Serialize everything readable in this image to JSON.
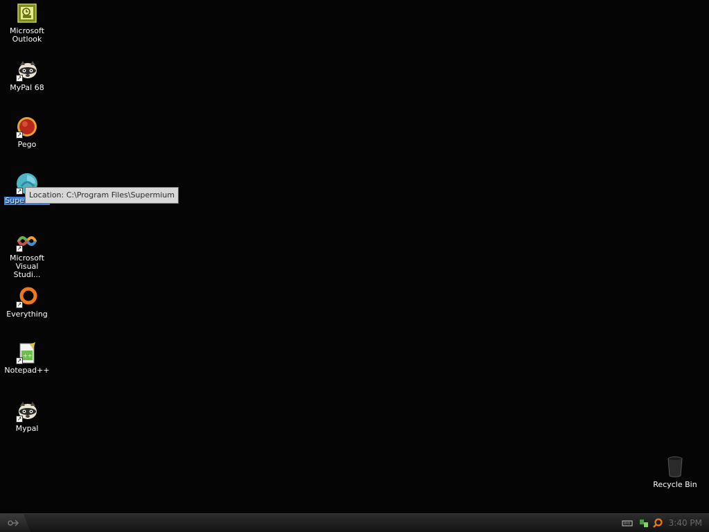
{
  "desktop": {
    "icons": [
      {
        "label": "Microsoft Outlook",
        "icon": "outlook-icon",
        "shortcut": false
      },
      {
        "label": "MyPal 68",
        "icon": "raccoon-icon",
        "shortcut": true
      },
      {
        "label": "Pego",
        "icon": "pego-icon",
        "shortcut": true
      },
      {
        "label": "Supermium",
        "icon": "supermium-icon",
        "shortcut": true,
        "selected": true
      },
      {
        "label": "Microsoft Visual Studi...",
        "icon": "visual-studio-icon",
        "shortcut": true
      },
      {
        "label": "Everything",
        "icon": "everything-icon",
        "shortcut": true
      },
      {
        "label": "Notepad++",
        "icon": "notepad-plus-plus-icon",
        "shortcut": true
      },
      {
        "label": "Mypal",
        "icon": "raccoon-icon",
        "shortcut": true
      }
    ],
    "tooltip": "Location: C:\\Program Files\\Supermium",
    "recycle_bin": {
      "label": "Recycle Bin",
      "icon": "recycle-bin-icon"
    }
  },
  "taskbar": {
    "start_icon": "start-icon",
    "tray_icons": [
      "keyboard-icon",
      "network-icon",
      "search-icon"
    ],
    "clock": "3:40 PM"
  },
  "colors": {
    "background": "#050505",
    "selection": "#3f7fd6",
    "tooltip_bg": "#d8d8d8",
    "taskbar": "#1f1f1f"
  }
}
